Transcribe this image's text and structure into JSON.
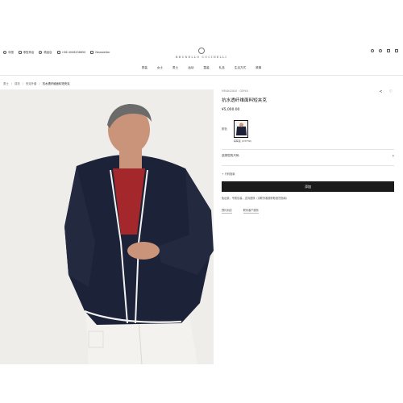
{
  "topbar": {
    "items": [
      {
        "icon": "globe-icon",
        "label": "中国"
      },
      {
        "icon": "store-icon",
        "label": "零售商店"
      },
      {
        "icon": "location-icon",
        "label": "精品店"
      },
      {
        "icon": "phone-icon",
        "label": "+86 4008208850"
      },
      {
        "icon": "mail-icon",
        "label": "Newsletter"
      }
    ],
    "right_icons": [
      "search-icon",
      "user-icon",
      "heart-icon",
      "bag-icon"
    ]
  },
  "logo": {
    "text": "BRUNELLO CUCINELLI"
  },
  "nav": {
    "items": [
      "男装",
      "女士",
      "男士",
      "运动",
      "童装",
      "礼品",
      "生活方式",
      "故事"
    ]
  },
  "breadcrumb": {
    "items": [
      "男士",
      "成衣",
      "夹克外套",
      "抗水透纤维面料短夹克"
    ]
  },
  "product": {
    "sku": "MR4842840 · CBP48",
    "title": "抗水透纤维面料短夹克",
    "price": "¥5,000.00",
    "color_label": "颜色",
    "swatch_name": "海军蓝 (C3739)",
    "size_label": "选择您的尺码",
    "fit_link": "+ 尺码指南",
    "add_label": "添加",
    "note": "免运费，专属包装，支持退换（请联系客服获取退货指南）",
    "links": [
      "预约到店",
      "联系客户服务"
    ]
  },
  "colors": {
    "accent": "#1a1a1a",
    "jacket": "#1c2338",
    "background": "#efedea"
  }
}
